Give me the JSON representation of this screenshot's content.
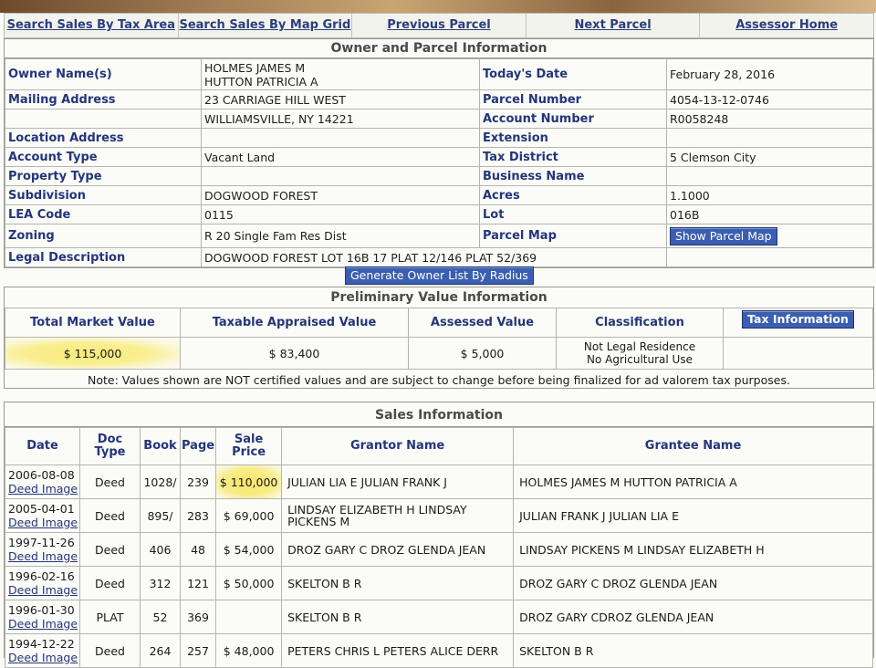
{
  "nav": {
    "tax_area": "Search Sales By Tax Area",
    "map_grid": "Search Sales By Map Grid",
    "previous": "Previous Parcel",
    "next": "Next Parcel",
    "home": "Assessor Home"
  },
  "owner_section": {
    "title": "Owner and Parcel Information",
    "owner_name_label": "Owner Name(s)",
    "owner_name_1": "HOLMES JAMES M",
    "owner_name_2": "HUTTON PATRICIA A",
    "mailing_label": "Mailing Address",
    "mailing_1": "23 CARRIAGE HILL WEST",
    "mailing_2": "WILLIAMSVILLE, NY 14221",
    "location_label": "Location Address",
    "location": "",
    "account_type_label": "Account Type",
    "account_type": "Vacant Land",
    "property_type_label": "Property Type",
    "property_type": "",
    "subdivision_label": "Subdivision",
    "subdivision": "DOGWOOD FOREST",
    "lea_label": "LEA Code",
    "lea": "0115",
    "zoning_label": "Zoning",
    "zoning": "R 20 Single Fam Res Dist",
    "legal_label": "Legal Description",
    "legal": "DOGWOOD FOREST LOT 16B 17 PLAT 12/146 PLAT 52/369",
    "today_label": "Today's Date",
    "today": "February 28, 2016",
    "parcel_label": "Parcel Number",
    "parcel": "4054-13-12-0746",
    "account_label": "Account Number",
    "account": "R0058248",
    "extension_label": "Extension",
    "extension": "",
    "tax_district_label": "Tax District",
    "tax_district": "5 Clemson City",
    "business_label": "Business Name",
    "business": "",
    "acres_label": "Acres",
    "acres": "1.1000",
    "lot_label": "Lot",
    "lot": "016B",
    "parcel_map_label": "Parcel Map",
    "show_map_button": "Show Parcel Map",
    "radius_button": "Generate Owner List By Radius"
  },
  "value_section": {
    "title": "Preliminary Value Information",
    "h_market": "Total Market Value",
    "h_taxable": "Taxable Appraised Value",
    "h_assessed": "Assessed Value",
    "h_class": "Classification",
    "tax_info_button": "Tax Information",
    "market": "$ 115,000",
    "taxable": "$ 83,400",
    "assessed": "$ 5,000",
    "class_1": "Not Legal Residence",
    "class_2": "No Agricultural Use",
    "note": "Note: Values shown are NOT certified values and are subject to change before being finalized for ad valorem tax purposes."
  },
  "sales_section": {
    "title": "Sales Information",
    "h_date": "Date",
    "h_doc_1": "Doc",
    "h_doc_2": "Type",
    "h_book": "Book",
    "h_page": "Page",
    "h_price": "Sale Price",
    "h_grantor": "Grantor Name",
    "h_grantee": "Grantee Name",
    "deed_image_label": "Deed Image",
    "rows": [
      {
        "date": "2006-08-08",
        "doc": "Deed",
        "book": "1028/",
        "page": "239",
        "price": "$ 110,000",
        "grantor": "JULIAN LIA E JULIAN FRANK J",
        "grantee": "HOLMES JAMES M HUTTON PATRICIA A"
      },
      {
        "date": "2005-04-01",
        "doc": "Deed",
        "book": "895/",
        "page": "283",
        "price": "$ 69,000",
        "grantor": "LINDSAY ELIZABETH H LINDSAY PICKENS M",
        "grantee": "JULIAN FRANK J JULIAN LIA E"
      },
      {
        "date": "1997-11-26",
        "doc": "Deed",
        "book": "406",
        "page": "48",
        "price": "$ 54,000",
        "grantor": "DROZ GARY C DROZ GLENDA JEAN",
        "grantee": "LINDSAY PICKENS M LINDSAY ELIZABETH H"
      },
      {
        "date": "1996-02-16",
        "doc": "Deed",
        "book": "312",
        "page": "121",
        "price": "$ 50,000",
        "grantor": "SKELTON B R",
        "grantee": "DROZ GARY C DROZ GLENDA JEAN"
      },
      {
        "date": "1996-01-30",
        "doc": "PLAT",
        "book": "52",
        "page": "369",
        "price": "",
        "grantor": "SKELTON B R",
        "grantee": "DROZ GARY CDROZ GLENDA JEAN"
      },
      {
        "date": "1994-12-22",
        "doc": "Deed",
        "book": "264",
        "page": "257",
        "price": "$ 48,000",
        "grantor": "PETERS CHRIS L PETERS ALICE DERR",
        "grantee": "SKELTON B R"
      }
    ]
  }
}
